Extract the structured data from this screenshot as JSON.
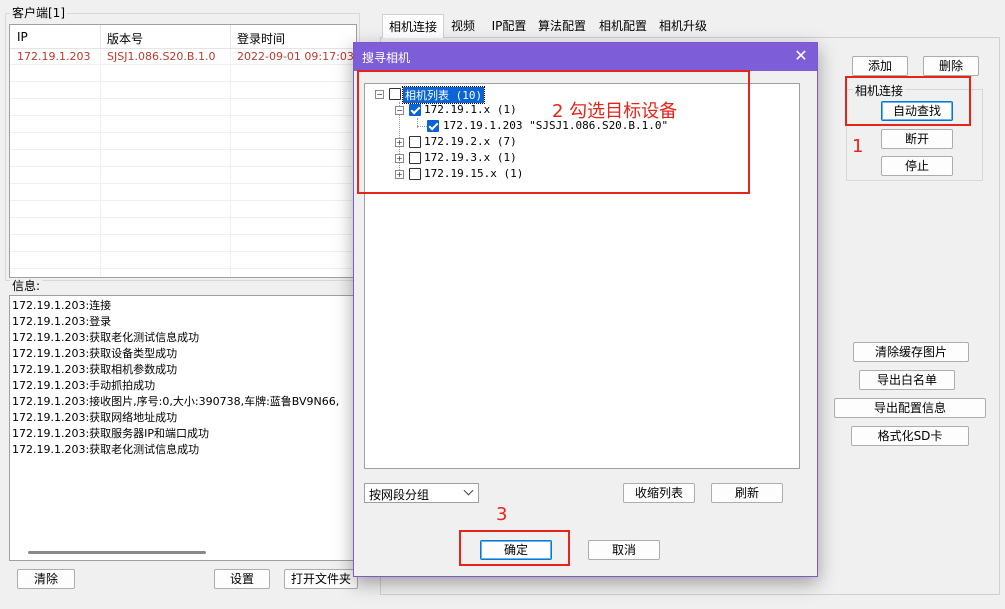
{
  "client_panel": {
    "title": "客户端[1]",
    "columns": [
      "IP",
      "版本号",
      "登录时间"
    ],
    "rows": [
      [
        "172.19.1.203",
        "SJSJ1.086.S20.B.1.0",
        "2022-09-01 09:17:03"
      ]
    ]
  },
  "info_panel": {
    "title": "信息:",
    "lines": [
      "172.19.1.203:连接",
      "172.19.1.203:登录",
      "172.19.1.203:获取老化测试信息成功",
      "172.19.1.203:获取设备类型成功",
      "172.19.1.203:获取相机参数成功",
      "172.19.1.203:手动抓拍成功",
      "172.19.1.203:接收图片,序号:0,大小:390738,车牌:蓝鲁BV9N66,",
      "172.19.1.203:获取网络地址成功",
      "172.19.1.203:获取服务器IP和端口成功",
      "172.19.1.203:获取老化测试信息成功"
    ]
  },
  "bottom_buttons": {
    "clear": "清除",
    "settings": "设置",
    "open_folder": "打开文件夹"
  },
  "tabs": [
    "相机连接",
    "视频",
    "IP配置",
    "算法配置",
    "相机配置",
    "相机升级"
  ],
  "right_panel": {
    "add": "添加",
    "delete": "删除",
    "group_title": "相机连接",
    "auto_search": "自动查找",
    "disconnect": "断开",
    "stop": "停止",
    "clear_cache": "清除缓存图片",
    "export_whitelist": "导出白名单",
    "export_config": "导出配置信息",
    "format_sd": "格式化SD卡"
  },
  "dialog": {
    "title": "搜寻相机",
    "close_glyph": "✕",
    "tree": {
      "root": "相机列表 (10)",
      "subnets": [
        {
          "label": "172.19.1.x  (1)",
          "checked": true,
          "expanded": true,
          "children": [
            {
              "label": "172.19.1.203  \"SJSJ1.086.S20.B.1.0\"",
              "checked": true
            }
          ]
        },
        {
          "label": "172.19.2.x  (7)",
          "checked": false,
          "expanded": false
        },
        {
          "label": "172.19.3.x  (1)",
          "checked": false,
          "expanded": false
        },
        {
          "label": "172.19.15.x  (1)",
          "checked": false,
          "expanded": false
        }
      ]
    },
    "group_select": "按网段分组",
    "collapse_list": "收缩列表",
    "refresh": "刷新",
    "ok": "确定",
    "cancel": "取消"
  },
  "annotations": {
    "step1": "1",
    "step2": "2 勾选目标设备",
    "step3": "3"
  },
  "colors": {
    "dialog_title_bg": "#7d5ed8",
    "annotation_red": "#e8231a",
    "client_row_text": "#c0392b",
    "checkbox_blue": "#0a64d6"
  }
}
